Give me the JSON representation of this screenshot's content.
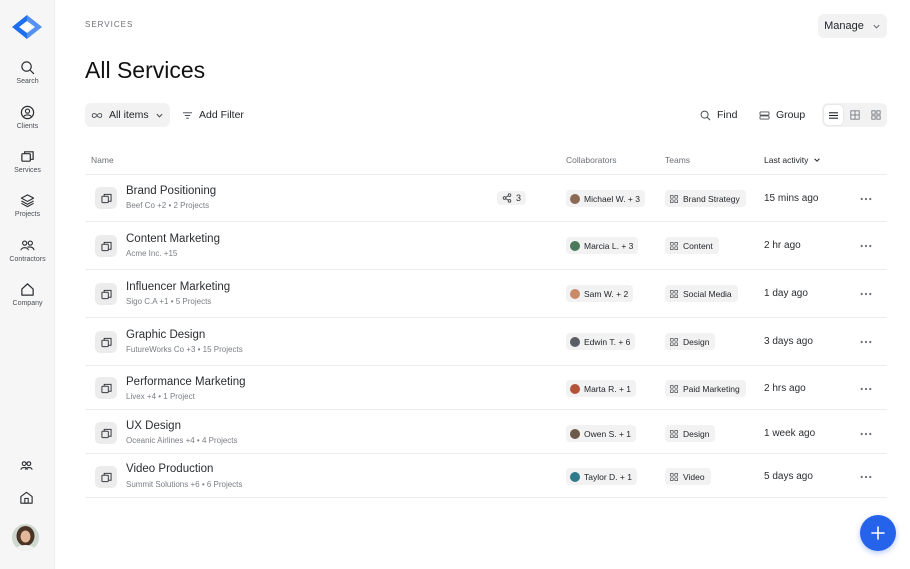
{
  "sidebar": {
    "items": [
      {
        "label": "Search",
        "icon": "search-icon"
      },
      {
        "label": "Clients",
        "icon": "user-circle-icon"
      },
      {
        "label": "Services",
        "icon": "stack-windows-icon"
      },
      {
        "label": "Projects",
        "icon": "layers-icon"
      },
      {
        "label": "Contractors",
        "icon": "users-icon"
      },
      {
        "label": "Company",
        "icon": "home-icon"
      }
    ]
  },
  "header": {
    "breadcrumb": "SERVICES",
    "manage_label": "Manage",
    "title": "All Services"
  },
  "toolbar": {
    "all_items_label": "All items",
    "add_filter_label": "Add Filter",
    "find_label": "Find",
    "group_label": "Group"
  },
  "table": {
    "columns": {
      "name": "Name",
      "collaborators": "Collaborators",
      "teams": "Teams",
      "last_activity": "Last activity"
    },
    "rows": [
      {
        "name": "Brand Positioning",
        "sub": "Beef Co +2  •  2 Projects",
        "shares": "3",
        "collaborator": "Michael W. + 3",
        "avatar_color": "#8a6a55",
        "team": "Brand Strategy",
        "activity": "15 mins ago"
      },
      {
        "name": "Content Marketing",
        "sub": "Acme Inc. +15",
        "collaborator": "Marcia L. + 3",
        "avatar_color": "#4a7a5a",
        "team": "Content",
        "activity": "2 hr ago"
      },
      {
        "name": "Influencer Marketing",
        "sub": "Sigo C.A +1  •  5 Projects",
        "collaborator": "Sam W. + 2",
        "avatar_color": "#c98a6a",
        "team": "Social Media",
        "activity": "1 day ago"
      },
      {
        "name": "Graphic Design",
        "sub": "FutureWorks Co +3  •  15 Projects",
        "collaborator": "Edwin T. + 6",
        "avatar_color": "#5a5f66",
        "team": "Design",
        "activity": "3 days ago"
      },
      {
        "name": "Performance Marketing",
        "sub": "Livex +4  •  1 Project",
        "collaborator": "Marta R. + 1",
        "avatar_color": "#b5533a",
        "team": "Paid Marketing",
        "activity": "2 hrs ago"
      },
      {
        "name": "UX Design",
        "sub": "Oceanic Airlines +4  •  4 Projects",
        "collaborator": "Owen S. + 1",
        "avatar_color": "#6b5a4a",
        "team": "Design",
        "activity": "1 week ago"
      },
      {
        "name": "Video Production",
        "sub": "Summit Solutions +6  •  6 Projects",
        "collaborator": "Taylor D. + 1",
        "avatar_color": "#2f7a8a",
        "team": "Video",
        "activity": "5 days ago"
      }
    ]
  },
  "colors": {
    "accent": "#2563eb",
    "logo": "#1e6ff0"
  }
}
